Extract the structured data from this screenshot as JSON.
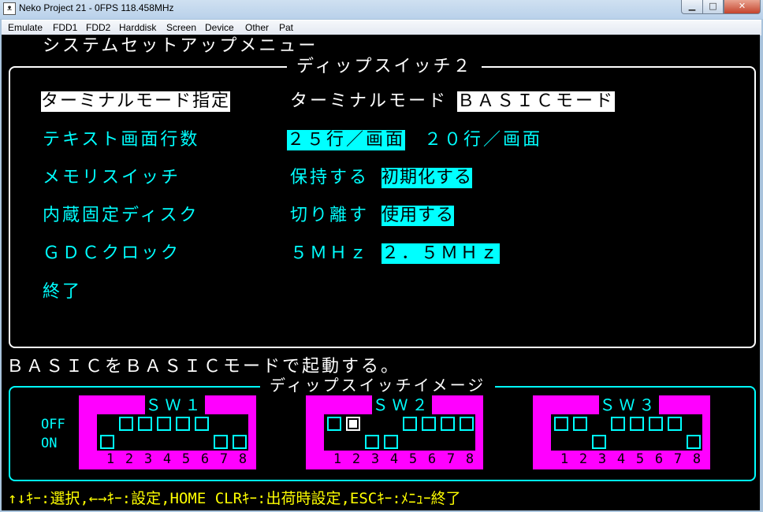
{
  "window": {
    "title": "Neko Project 21 - 0FPS 118.458MHz",
    "icon": "cat-app-icon",
    "buttons": {
      "minimize": "▁",
      "maximize": "□",
      "close": "✕"
    }
  },
  "menubar": {
    "items": [
      "Emulate",
      "FDD1",
      "FDD2",
      "Harddisk",
      "Screen",
      "Device",
      "Other",
      "Pat"
    ]
  },
  "screen": {
    "heading": "システムセットアップメニュー",
    "panel_title": "ディップスイッチ２",
    "settings": [
      {
        "label": "ターミナルモード指定",
        "options": [
          {
            "text": "ターミナルモード",
            "selected": false
          },
          {
            "text": "ＢＡＳＩＣモード",
            "selected": true
          }
        ],
        "focused": true
      },
      {
        "label": "テキスト画面行数",
        "options": [
          {
            "text": "２５行／画面",
            "selected": true
          },
          {
            "text": "２０行／画面",
            "selected": false
          }
        ],
        "focused": false
      },
      {
        "label": "メモリスイッチ",
        "options": [
          {
            "text": "保持する",
            "selected": false
          },
          {
            "text": "初期化する",
            "selected": true
          }
        ],
        "focused": false
      },
      {
        "label": "内蔵固定ディスク",
        "options": [
          {
            "text": "切り離す",
            "selected": false
          },
          {
            "text": "使用する",
            "selected": true
          }
        ],
        "focused": false
      },
      {
        "label": "ＧＤＣクロック",
        "options": [
          {
            "text": "５ＭＨｚ",
            "selected": false
          },
          {
            "text": "２．５ＭＨｚ",
            "selected": true
          }
        ],
        "focused": false
      },
      {
        "label": "終了",
        "options": [],
        "focused": false
      }
    ],
    "description": "ＢＡＳＩＣをＢＡＳＩＣモードで起動する。",
    "dip_panel_title": "ディップスイッチイメージ",
    "off_label": "OFF",
    "on_label": "ON",
    "switches": [
      {
        "name": "ＳＷ１",
        "positions": [
          "on",
          "off",
          "off",
          "off",
          "off",
          "off",
          "on",
          "on"
        ],
        "selected_index": -1
      },
      {
        "name": "ＳＷ２",
        "positions": [
          "off",
          "off",
          "on",
          "on",
          "off",
          "off",
          "off",
          "off"
        ],
        "selected_index": 1
      },
      {
        "name": "ＳＷ３",
        "positions": [
          "off",
          "off",
          "on",
          "off",
          "off",
          "off",
          "off",
          "on"
        ],
        "selected_index": -1
      }
    ],
    "switch_numbers": [
      "1",
      "2",
      "3",
      "4",
      "5",
      "6",
      "7",
      "8"
    ],
    "help": "↑↓ｷｰ:選択,←→ｷｰ:設定,HOME CLRｷｰ:出荷時設定,ESCｷｰ:ﾒﾆｭｰ終了"
  },
  "colors": {
    "background": "#000000",
    "text_cyan": "#00ffff",
    "text_white": "#ffffff",
    "text_yellow": "#ffff00",
    "switch_body": "#ff00ff"
  }
}
